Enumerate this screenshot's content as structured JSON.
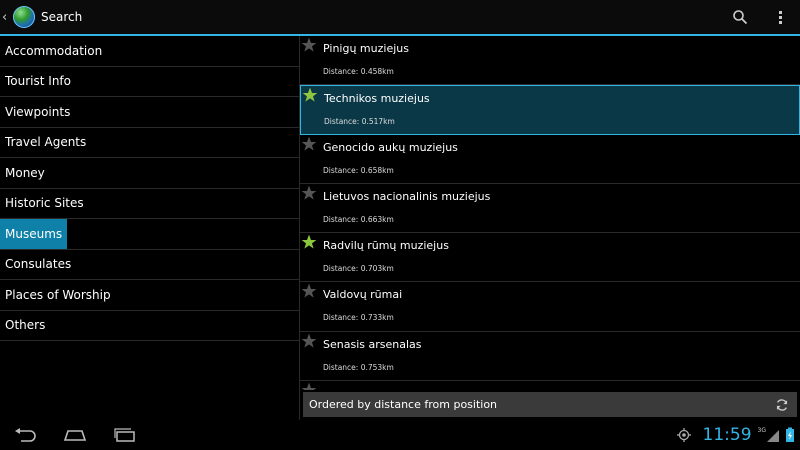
{
  "app": {
    "title": "Search",
    "colors": {
      "accent": "#33b5e5",
      "selected_category": "#0f81a8",
      "star_active": "#8dc63f",
      "star_inactive": "#555555"
    }
  },
  "categories": [
    {
      "label": "Accommodation",
      "selected": false
    },
    {
      "label": "Tourist Info",
      "selected": false
    },
    {
      "label": "Viewpoints",
      "selected": false
    },
    {
      "label": "Travel Agents",
      "selected": false
    },
    {
      "label": "Money",
      "selected": false
    },
    {
      "label": "Historic Sites",
      "selected": false
    },
    {
      "label": "Museums",
      "selected": true
    },
    {
      "label": "Consulates",
      "selected": false
    },
    {
      "label": "Places of Worship",
      "selected": false
    },
    {
      "label": "Others",
      "selected": false
    }
  ],
  "results": [
    {
      "name": "Pinigų muziejus",
      "distance": "Distance: 0.458km",
      "favorite": false,
      "selected": false
    },
    {
      "name": "Technikos muziejus",
      "distance": "Distance: 0.517km",
      "favorite": true,
      "selected": true
    },
    {
      "name": "Genocido aukų muziejus",
      "distance": "Distance: 0.658km",
      "favorite": false,
      "selected": false
    },
    {
      "name": "Lietuvos nacionalinis muziejus",
      "distance": "Distance: 0.663km",
      "favorite": false,
      "selected": false
    },
    {
      "name": "Radvilų rūmų muziejus",
      "distance": "Distance: 0.703km",
      "favorite": true,
      "selected": false
    },
    {
      "name": "Valdovų rūmai",
      "distance": "Distance: 0.733km",
      "favorite": false,
      "selected": false
    },
    {
      "name": "Senasis arsenalas",
      "distance": "Distance: 0.753km",
      "favorite": false,
      "selected": false
    },
    {
      "name": "",
      "distance": "",
      "favorite": false,
      "selected": false
    }
  ],
  "order_bar": {
    "text": "Ordered by distance from position"
  },
  "status": {
    "time": "11:59",
    "network": "3G"
  },
  "icons": {
    "up": "chevron-left-icon",
    "search": "search-icon",
    "overflow": "overflow-menu-icon",
    "refresh": "refresh-icon",
    "back": "back-icon",
    "home": "home-icon",
    "recents": "recent-apps-icon",
    "gps": "gps-icon"
  }
}
